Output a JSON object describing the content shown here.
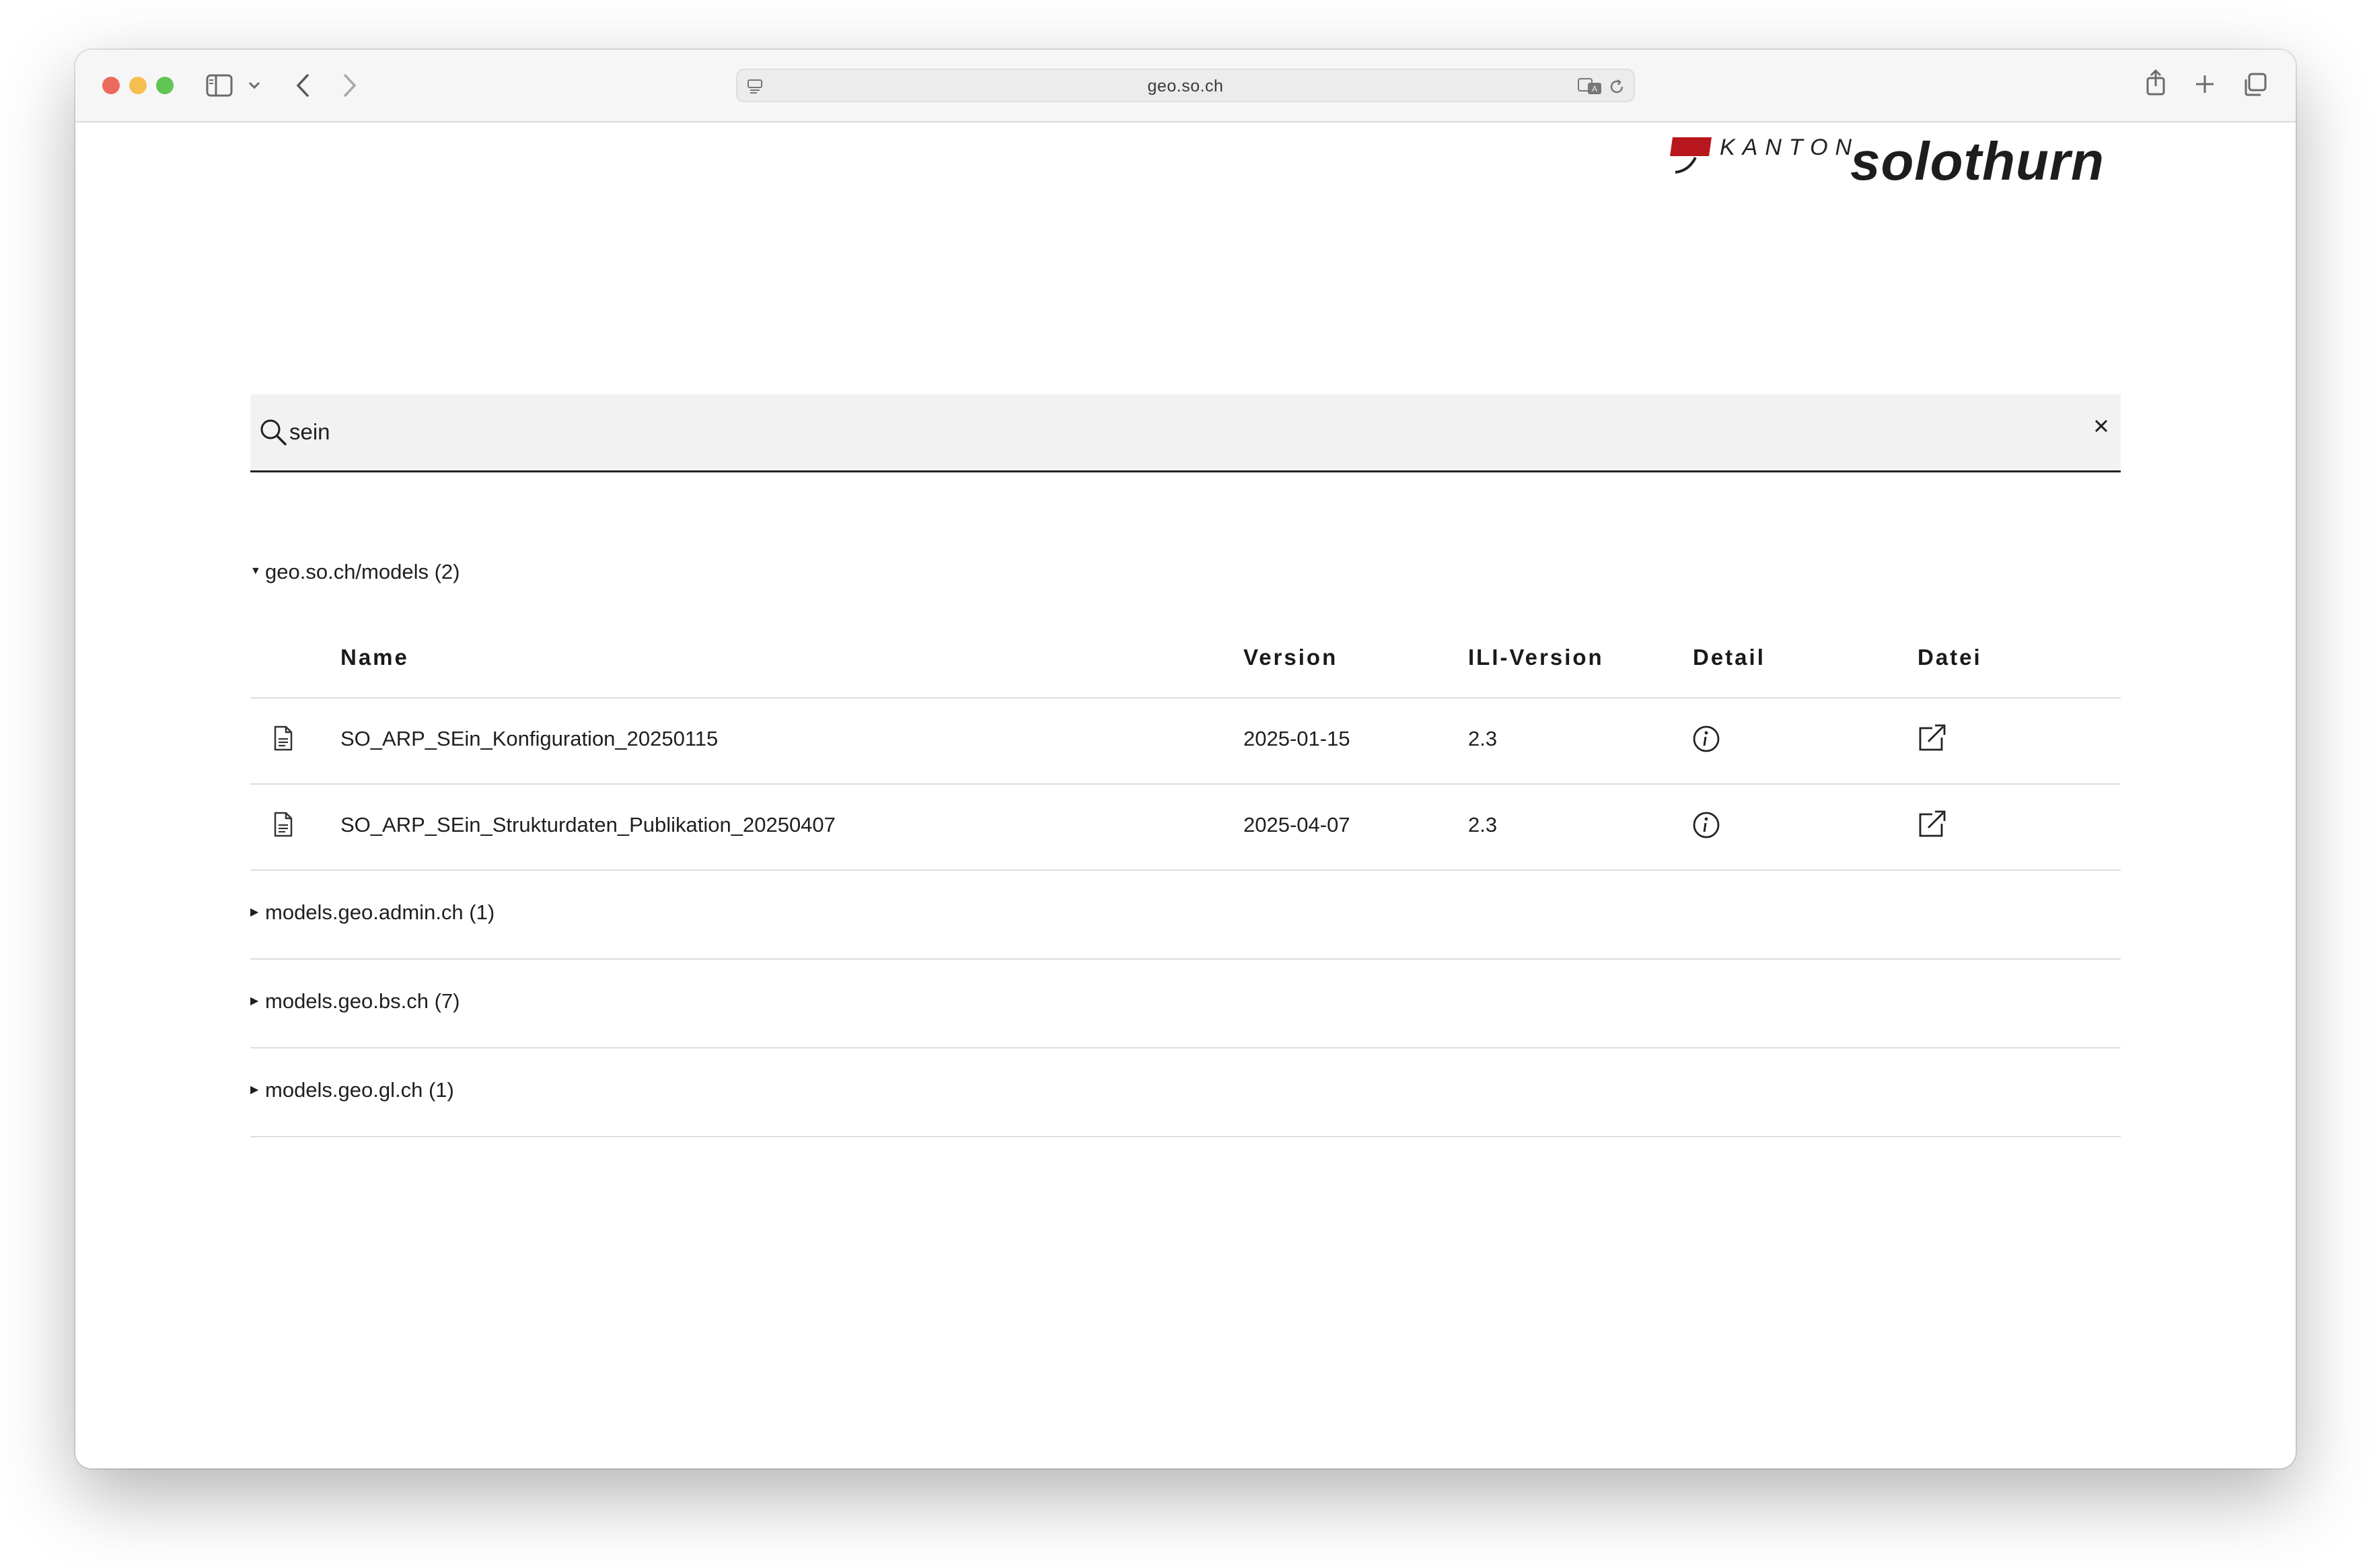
{
  "browser": {
    "url": "geo.so.ch",
    "traffic_lights": {
      "close": "#ed6a5e",
      "minimize": "#f5bf4f",
      "maximize": "#61c554"
    }
  },
  "logo": {
    "kanton": "KANTON",
    "name": "solothurn",
    "flag_color": "#b8171d"
  },
  "search": {
    "value": "sein"
  },
  "groups": [
    {
      "label": "geo.so.ch/models (2)",
      "expanded": true
    },
    {
      "label": "models.geo.admin.ch (1)",
      "expanded": false
    },
    {
      "label": "models.geo.bs.ch (7)",
      "expanded": false
    },
    {
      "label": "models.geo.gl.ch (1)",
      "expanded": false
    }
  ],
  "table": {
    "headers": {
      "name": "Name",
      "version": "Version",
      "ili_version": "ILI-Version",
      "detail": "Detail",
      "datei": "Datei"
    },
    "rows": [
      {
        "name": "SO_ARP_SEin_Konfiguration_20250115",
        "version": "2025-01-15",
        "ili_version": "2.3",
        "icon": "file-icon",
        "detail_icon": "info-icon",
        "datei_icon": "external-link-icon"
      },
      {
        "name": "SO_ARP_SEin_Strukturdaten_Publikation_20250407",
        "version": "2025-04-07",
        "ili_version": "2.3",
        "icon": "file-icon",
        "detail_icon": "info-icon",
        "datei_icon": "external-link-icon"
      }
    ]
  }
}
